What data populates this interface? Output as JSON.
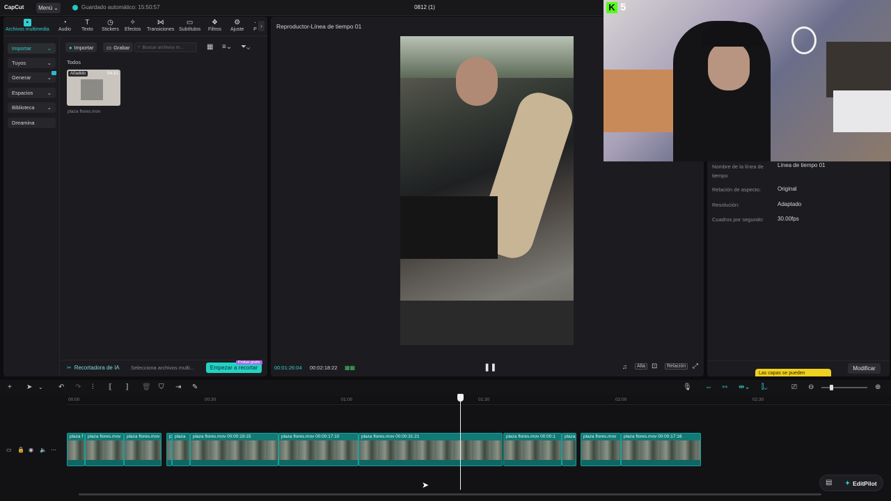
{
  "app": {
    "logo": "CapCut",
    "menu": "Menú",
    "autosave": "Guardado automático: 15:50:57",
    "project_name": "0812 (1)"
  },
  "tabs": [
    {
      "label": "Archivos multimedia",
      "icon": "media-icon"
    },
    {
      "label": "Audio",
      "icon": "audio-icon"
    },
    {
      "label": "Texto",
      "icon": "text-icon"
    },
    {
      "label": "Stickers",
      "icon": "sticker-icon"
    },
    {
      "label": "Efectos",
      "icon": "effects-icon"
    },
    {
      "label": "Transiciones",
      "icon": "transitions-icon"
    },
    {
      "label": "Subtítulos",
      "icon": "subtitles-icon"
    },
    {
      "label": "Filtros",
      "icon": "filters-icon"
    },
    {
      "label": "Ajuste",
      "icon": "adjust-icon"
    },
    {
      "label": "P",
      "icon": "more-icon"
    }
  ],
  "sidebar": {
    "items": [
      {
        "label": "Importar"
      },
      {
        "label": "Tuyos"
      },
      {
        "label": "Generar"
      },
      {
        "label": "Espacios"
      },
      {
        "label": "Biblioteca"
      },
      {
        "label": "Dreamina"
      }
    ]
  },
  "media": {
    "import_label": "Importar",
    "record_label": "Grabar",
    "search_placeholder": "Buscar archivos m...",
    "section_label": "Todos",
    "item": {
      "badge": "Añadido",
      "duration": "04:31",
      "name": "plaza flores.mov"
    },
    "ai_cutter_label": "Recortadora de IA",
    "select_files_label": "Selecciona archivos multi...",
    "start_cut_label": "Empezar a recortar",
    "free_badge": "Probar gratis"
  },
  "player": {
    "title": "Reproductor-Línea de tiempo 01",
    "current_time": "00:01:26:04",
    "total_time": "00:02:18:22",
    "quality_label": "Alta",
    "ratio_label": "Relación"
  },
  "details": {
    "timeline_name_label": "Nombre de la línea de tiempo",
    "timeline_name_value": "Línea de tiempo 01",
    "aspect_label": "Relación de aspecto:",
    "aspect_value": "Original",
    "resolution_label": "Resolución:",
    "resolution_value": "Adaptado",
    "fps_label": "Cuadros por segundo:",
    "fps_value": "30.00fps",
    "tooltip": "Las capas se pueden",
    "modify_label": "Modificar"
  },
  "webcam": {
    "overlay_number": "5"
  },
  "timeline": {
    "ruler": [
      "00:00",
      "00:30",
      "01:00",
      "01:30",
      "02:00",
      "02:30"
    ],
    "clips": [
      {
        "label": "plaza f"
      },
      {
        "label": "plaza flores.mov"
      },
      {
        "label": "plaza flores.mov"
      },
      {
        "label": "p"
      },
      {
        "label": "plaza"
      },
      {
        "label": "plaza flores.mov   00:00:19:15"
      },
      {
        "label": "plaza flores.mov   00:00:17:10"
      },
      {
        "label": "plaza flores.mov   00:00:31:21"
      },
      {
        "label": "plaza flores.mov   00:00:1"
      },
      {
        "label": "plaza"
      },
      {
        "label": "plaza flores.mov"
      },
      {
        "label": "plaza flores.mov   00:00:17:16"
      }
    ]
  },
  "editpilot": {
    "label": "EditPilot"
  },
  "colors": {
    "accent": "#2fd0d0",
    "clip": "#117a76",
    "bg": "#0d0d0f"
  }
}
